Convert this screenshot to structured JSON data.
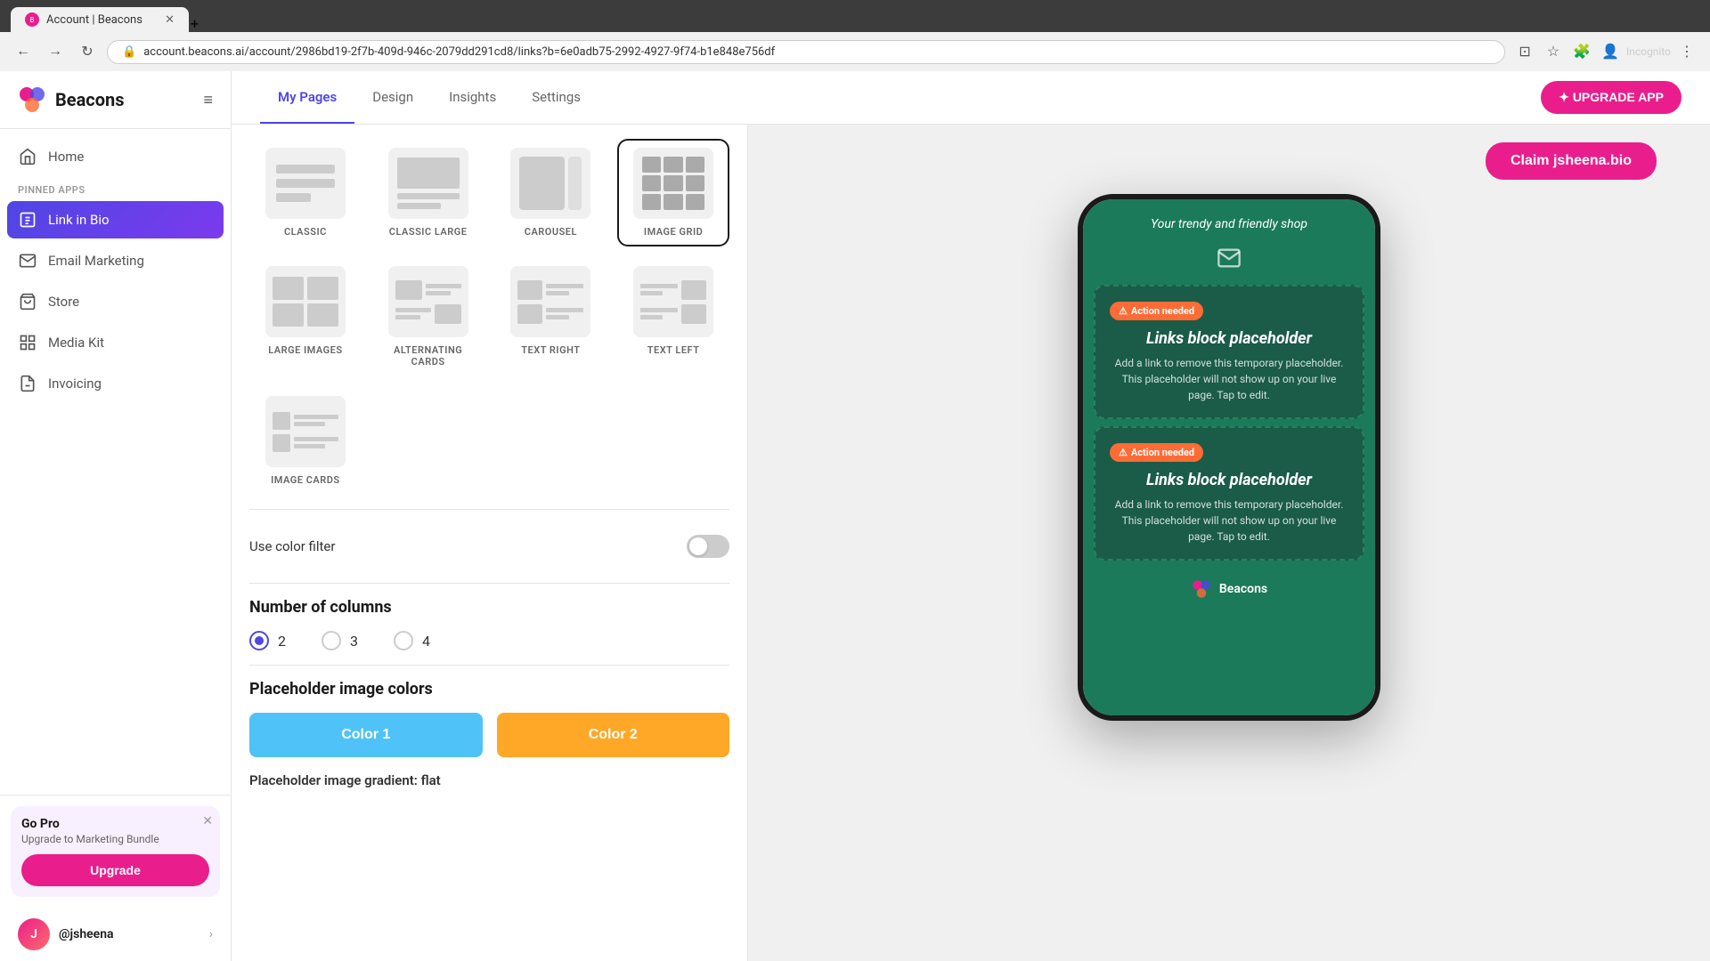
{
  "browser": {
    "tab_title": "Account | Beacons",
    "url": "account.beacons.ai/account/2986bd19-2f7b-409d-946c-2079dd291cd8/links?b=6e0adb75-2992-4927-9f74-b1e848e756df",
    "incognito_label": "Incognito"
  },
  "sidebar": {
    "logo_text": "Beacons",
    "nav_items": [
      {
        "label": "Home",
        "icon": "home-icon"
      },
      {
        "label": "Link in Bio",
        "icon": "link-icon",
        "active": true,
        "pinned": true
      },
      {
        "label": "Email Marketing",
        "icon": "email-icon"
      },
      {
        "label": "Store",
        "icon": "store-icon"
      },
      {
        "label": "Media Kit",
        "icon": "media-kit-icon"
      },
      {
        "label": "Invoicing",
        "icon": "invoicing-icon"
      }
    ],
    "pinned_section_label": "PINNED APPS",
    "go_pro": {
      "title": "Go Pro",
      "description": "Upgrade to Marketing Bundle",
      "button_label": "Upgrade"
    },
    "user": {
      "name": "@jsheena",
      "avatar_initials": "J"
    }
  },
  "header": {
    "tabs": [
      "My Pages",
      "Design",
      "Insights",
      "Settings"
    ],
    "active_tab": "My Pages",
    "upgrade_button": "✦ UPGRADE APP"
  },
  "panel": {
    "layouts": [
      {
        "id": "classic",
        "label": "CLASSIC",
        "selected": false
      },
      {
        "id": "classic-large",
        "label": "CLASSIC LARGE",
        "selected": false
      },
      {
        "id": "carousel",
        "label": "CAROUSEL",
        "selected": false
      },
      {
        "id": "image-grid",
        "label": "IMAGE GRID",
        "selected": true
      },
      {
        "id": "large-images",
        "label": "LARGE IMAGES",
        "selected": false
      },
      {
        "id": "alternating-cards",
        "label": "ALTERNATING CARDS",
        "selected": false
      },
      {
        "id": "text-right",
        "label": "TEXT RIGHT",
        "selected": false
      },
      {
        "id": "text-left",
        "label": "TEXT LEFT",
        "selected": false
      },
      {
        "id": "image-cards",
        "label": "IMAGE CARDS",
        "selected": false
      }
    ],
    "color_filter": {
      "label": "Use color filter",
      "enabled": false
    },
    "columns": {
      "title": "Number of columns",
      "options": [
        "2",
        "3",
        "4"
      ],
      "selected": "2"
    },
    "placeholder_colors": {
      "title": "Placeholder image colors",
      "color1_label": "Color 1",
      "color2_label": "Color 2",
      "color1_bg": "#4fc3f7",
      "color2_bg": "#ffa726"
    },
    "gradient_label": "Placeholder image gradient:",
    "gradient_value": "flat"
  },
  "preview": {
    "claim_button": "Claim jsheena.bio",
    "phone": {
      "header_text": "Your trendy and friendly shop",
      "cards": [
        {
          "badge": "⚠ Action needed",
          "title": "Links block placeholder",
          "text": "Add a link to remove this temporary placeholder. This placeholder will not show up on your live page. Tap to edit."
        },
        {
          "badge": "⚠ Action needed",
          "title": "Links block placeholder",
          "text": "Add a link to remove this temporary placeholder. This placeholder will not show up on your live page. Tap to edit."
        }
      ],
      "footer": "Beacons"
    }
  }
}
